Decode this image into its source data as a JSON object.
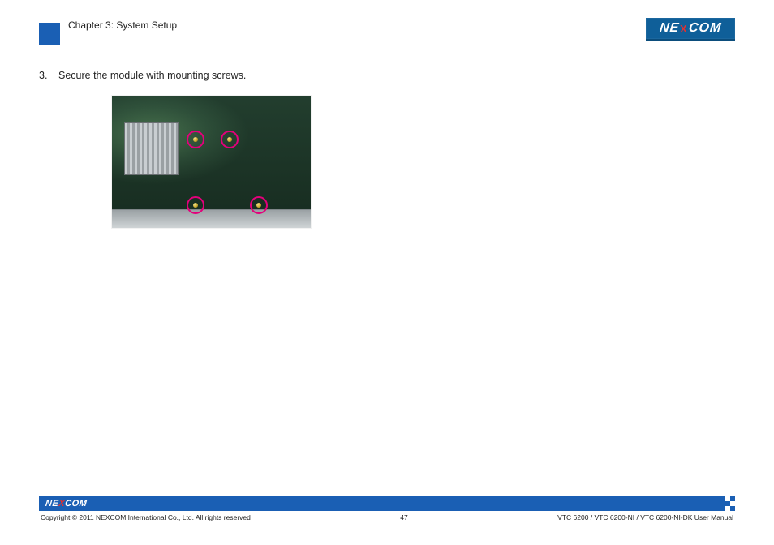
{
  "header": {
    "chapter": "Chapter 3: System Setup",
    "brand": {
      "pre": "NE",
      "x": "X",
      "post": "COM"
    }
  },
  "step": {
    "num": "3.",
    "text": "Secure the module with mounting screws."
  },
  "figure": {
    "alt": "Circuit board photograph with four mounting-screw locations circled",
    "screw_count": 4
  },
  "footer": {
    "brand": {
      "pre": "NE",
      "x": "X",
      "post": "COM"
    },
    "copyright": "Copyright © 2011 NEXCOM International Co., Ltd. All rights reserved",
    "page": "47",
    "doc": "VTC 6200 / VTC 6200-NI / VTC 6200-NI-DK User Manual"
  }
}
